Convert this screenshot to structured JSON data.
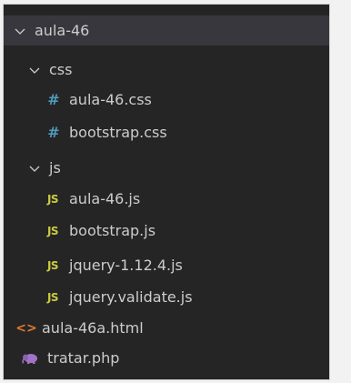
{
  "explorer": {
    "root": {
      "label": "aula-46"
    },
    "css_folder": {
      "label": "css"
    },
    "css_files": [
      {
        "label": "aula-46.css",
        "icon": "css-hash-icon"
      },
      {
        "label": "bootstrap.css",
        "icon": "css-hash-icon"
      }
    ],
    "js_folder": {
      "label": "js"
    },
    "js_files": [
      {
        "label": "aula-46.js",
        "icon": "js-icon"
      },
      {
        "label": "bootstrap.js",
        "icon": "js-icon"
      },
      {
        "label": "jquery-1.12.4.js",
        "icon": "js-icon"
      },
      {
        "label": "jquery.validate.js",
        "icon": "js-icon"
      }
    ],
    "root_files": [
      {
        "label": "aula-46a.html",
        "icon": "html-icon"
      },
      {
        "label": "tratar.php",
        "icon": "php-elephant-icon"
      }
    ],
    "icon_glyphs": {
      "css": "#",
      "js": "JS",
      "html": "<>"
    },
    "colors": {
      "background": "#252526",
      "selected_row": "#37373d",
      "text": "#cccccc",
      "css_icon": "#519aba",
      "js_icon": "#cbcb41",
      "html_icon": "#e37933",
      "php_icon": "#a074c4"
    }
  }
}
